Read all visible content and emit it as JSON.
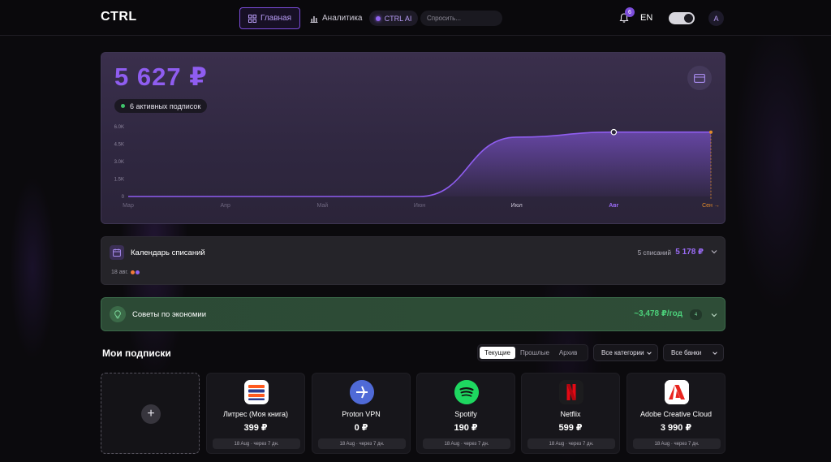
{
  "header": {
    "logo": "CTRL",
    "nav_home": "Главная",
    "nav_analytics": "Аналитика",
    "ai_label": "CTRL AI",
    "ai_placeholder": "Спросить...",
    "notifications_count": "6",
    "lang": "EN",
    "avatar_initial": "A"
  },
  "balance": {
    "amount": "5 627 ₽",
    "active_subs": "6 активных подписок"
  },
  "chart_data": {
    "type": "area",
    "y_ticks": [
      "0",
      "1.5K",
      "3.0K",
      "4.5K",
      "6.0K"
    ],
    "categories": [
      "Мар",
      "Апр",
      "Май",
      "Июн",
      "Июл",
      "Авг",
      "Сен →"
    ],
    "values": [
      0,
      0,
      0,
      0,
      5100,
      5530,
      5530
    ],
    "ylim": [
      0,
      6000
    ],
    "colors": {
      "line": "#8f5df0",
      "highlight": "#8f5df0",
      "future": "#e08a2a"
    }
  },
  "calendar": {
    "title": "Календарь списаний",
    "count": "5 списаний",
    "total": "5 178 ₽",
    "date": "18 авг."
  },
  "tips": {
    "title": "Советы по экономии",
    "value": "~3,478 ₽/год",
    "badge": "4"
  },
  "subscriptions": {
    "title": "Мои подписки",
    "tabs": [
      "Текущие",
      "Прошлые",
      "Архив"
    ],
    "category_filter": "Все категории",
    "bank_filter": "Все банки",
    "items": [
      {
        "name": "Литрес (Моя книга)",
        "price": "399 ₽",
        "next": "18 Aug · через 7 дн.",
        "logo": "litres-logo"
      },
      {
        "name": "Proton VPN",
        "price": "0 ₽",
        "next": "18 Aug · через 7 дн.",
        "logo": "protonvpn-logo"
      },
      {
        "name": "Spotify",
        "price": "190 ₽",
        "next": "18 Aug · через 7 дн.",
        "logo": "spotify-logo"
      },
      {
        "name": "Netflix",
        "price": "599 ₽",
        "next": "18 Aug · через 7 дн.",
        "logo": "netflix-logo"
      },
      {
        "name": "Adobe Creative Cloud",
        "price": "3 990 ₽",
        "next": "18 Aug · через 7 дн.",
        "logo": "adobe-logo"
      }
    ]
  }
}
